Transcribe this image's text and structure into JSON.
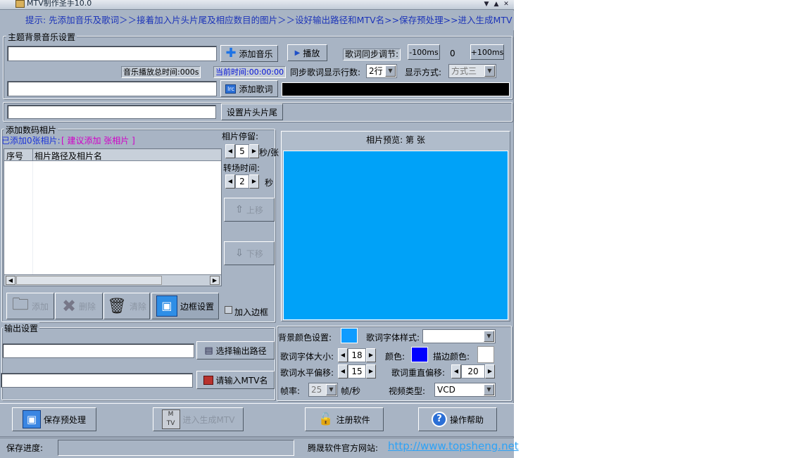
{
  "window": {
    "title": "MTV制作圣手10.0"
  },
  "hint": "提示: 先添加音乐及歌词＞＞接着加入片头片尾及相应数目的图片＞＞设好输出路径和MTV名>>保存预处理>>进入生成MTV",
  "music": {
    "legend": "主题背景音乐设置",
    "add_music": "添加音乐",
    "play": "播放",
    "sync_label": "歌词同步调节:",
    "minus": "-100ms",
    "offset": "0",
    "plus": "+100ms",
    "total_time": "音乐播放总时间:000s",
    "current_time": "当前时间:00:00:00",
    "lines_label": "同步歌词显示行数:",
    "lines_value": "2行",
    "display_label": "显示方式:",
    "display_value": "方式三",
    "add_lyrics": "添加歌词"
  },
  "header": {
    "button": "设置片头片尾"
  },
  "photos": {
    "legend": "添加数码相片",
    "count_prefix": "已添加0张相片:",
    "suggest": "[ 建议添加 张相片 ]",
    "col_no": "序号",
    "col_path": "相片路径及相片名",
    "stay_label": "相片停留:",
    "stay_value": "5",
    "stay_unit": "秒/张",
    "trans_label": "转场时间:",
    "trans_value": "2",
    "trans_unit": "秒",
    "move_up": "上移",
    "move_down": "下移",
    "add": "添加",
    "delete": "删除",
    "clear": "清除",
    "border": "边框设置",
    "add_border": "加入边框",
    "preview_title": "相片预览: 第  张"
  },
  "output": {
    "legend": "输出设置",
    "choose_path": "选择输出路径",
    "input_name": "请输入MTV名"
  },
  "style": {
    "bg_color_label": "背景颜色设置:",
    "font_style_label": "歌词字体样式:",
    "font_size_label": "歌词字体大小:",
    "font_size": "18",
    "color_label": "颜色:",
    "stroke_label": "描边颜色:",
    "h_offset_label": "歌词水平偏移:",
    "h_offset": "15",
    "v_offset_label": "歌词重直偏移:",
    "v_offset": "20",
    "fps_label": "帧率:",
    "fps": "25",
    "fps_unit": "帧/秒",
    "video_type_label": "视频类型:",
    "video_type": "VCD"
  },
  "actions": {
    "save": "保存预处理",
    "enter": "进入生成MTV",
    "register": "注册软件",
    "help": "操作帮助"
  },
  "status": {
    "progress_label": "保存进度:",
    "site_label": "腾晟软件官方网站:",
    "site_url": "http://www.topsheng.net"
  },
  "colors": {
    "preview": "#00a2f8",
    "bg_color": "#0f9cff",
    "lyric_color": "#0000ff",
    "stroke_color": "#ffffff",
    "hint_text": "#1c34b8",
    "link": "#2da2f6"
  }
}
